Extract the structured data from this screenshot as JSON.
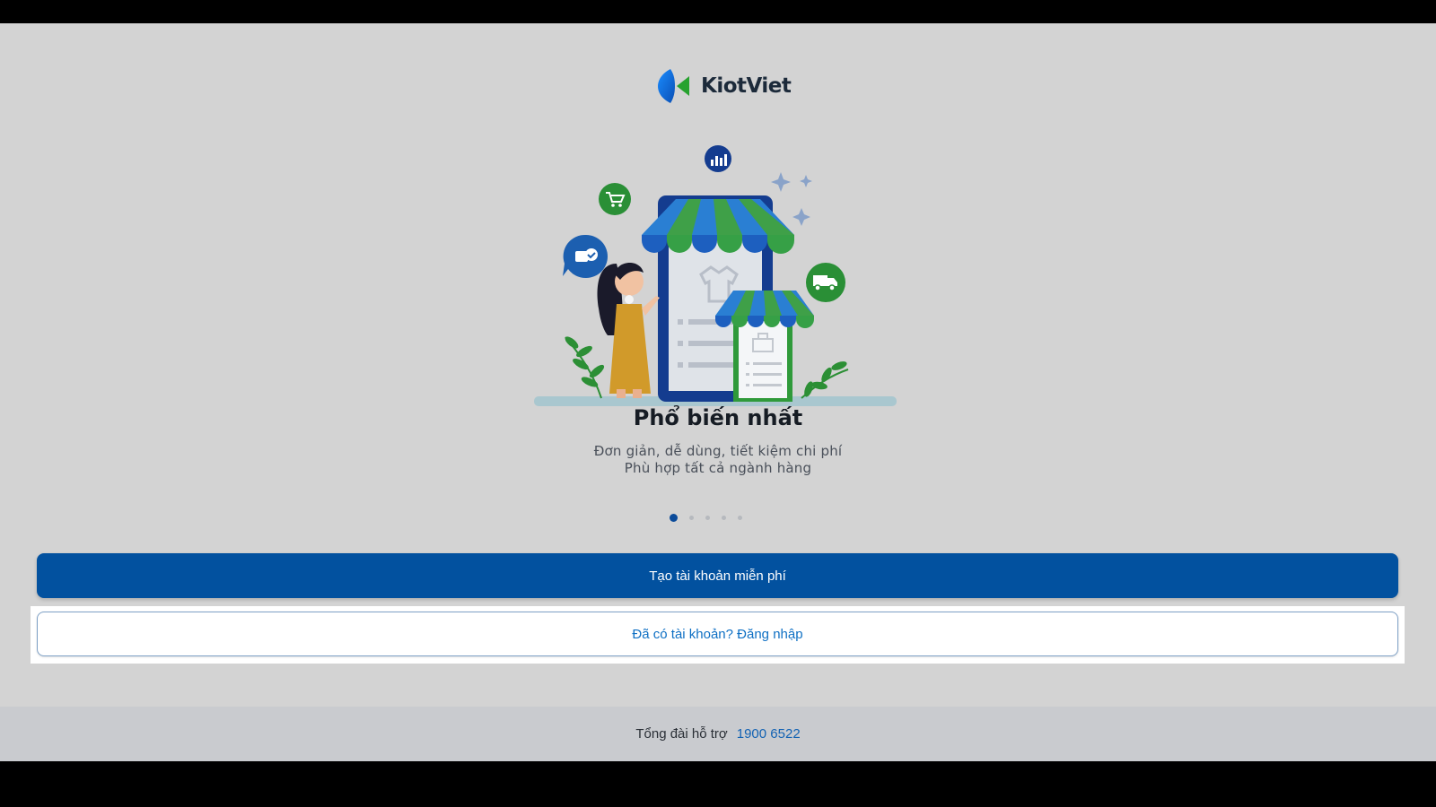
{
  "app": {
    "brand_name": "KiotViet",
    "colors": {
      "primary": "#02519f",
      "brand_blue": "#1e6fd9",
      "brand_green": "#27a22f",
      "background": "#d3d3d3",
      "footer_background": "#c9cbcf",
      "link": "#1262b3"
    }
  },
  "onboarding": {
    "headline": "Phổ biến nhất",
    "subtitle_line1": "Đơn giản, dễ dùng, tiết kiệm chi phí",
    "subtitle_line2": "Phù hợp tất cả ngành hàng",
    "illustration_icons": [
      "analytics-icon",
      "cart-icon",
      "box-check-icon",
      "delivery-truck-icon",
      "sparkle-icon",
      "tshirt-icon"
    ],
    "carousel": {
      "total_pages": 5,
      "active_page": 1
    }
  },
  "actions": {
    "create_account": "Tạo tài khoản miễn phí",
    "login": "Đã có tài khoản? Đăng nhập"
  },
  "footer": {
    "support_label": "Tổng đài hỗ trợ",
    "support_phone": "1900 6522"
  }
}
